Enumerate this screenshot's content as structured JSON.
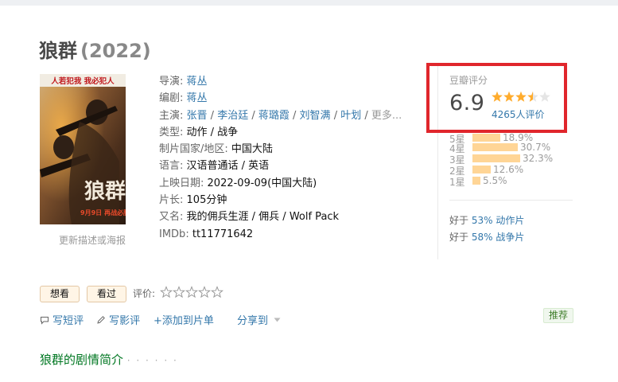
{
  "movie": {
    "title": "狼群",
    "year": "(2022)"
  },
  "poster": {
    "tagline": "人若犯我 我必犯人",
    "title_art": "狼群",
    "release_art": "9月9日 再战必胜",
    "update_link": "更新描述或海报"
  },
  "info": {
    "director": {
      "label": "导演:",
      "names": [
        "蒋丛"
      ]
    },
    "writer": {
      "label": "编剧:",
      "names": [
        "蒋丛"
      ]
    },
    "cast": {
      "label": "主演:",
      "names": [
        "张晋",
        "李治廷",
        "蒋璐霞",
        "刘智满",
        "叶划"
      ],
      "more": "更多..."
    },
    "genre": {
      "label": "类型:",
      "value": "动作 / 战争"
    },
    "country": {
      "label": "制片国家/地区:",
      "value": "中国大陆"
    },
    "language": {
      "label": "语言:",
      "value": "汉语普通话 / 英语"
    },
    "release": {
      "label": "上映日期:",
      "value": "2022-09-09(中国大陆)"
    },
    "runtime": {
      "label": "片长:",
      "value": "105分钟"
    },
    "aka": {
      "label": "又名:",
      "value": "我的佣兵生涯 / 佣兵 / Wolf Pack"
    },
    "imdb": {
      "label": "IMDb:",
      "value": "tt11771642"
    }
  },
  "rating": {
    "tag": "豆瓣评分",
    "score": "6.9",
    "stars": 3.5,
    "count": "4265人评价",
    "highlight_color": "#e0262c",
    "distribution": [
      {
        "label": "5星",
        "pct": "18.9%",
        "value": 18.9
      },
      {
        "label": "4星",
        "pct": "30.7%",
        "value": 30.7
      },
      {
        "label": "3星",
        "pct": "32.3%",
        "value": 32.3
      },
      {
        "label": "2星",
        "pct": "12.6%",
        "value": 12.6
      },
      {
        "label": "1星",
        "pct": "5.5%",
        "value": 5.5
      }
    ],
    "better_than": [
      {
        "prefix": "好于",
        "pct": "53%",
        "genre": "动作片"
      },
      {
        "prefix": "好于",
        "pct": "58%",
        "genre": "战争片"
      }
    ]
  },
  "actions": {
    "want": "想看",
    "seen": "看过",
    "my_rating_label": "评价:",
    "write_short": "写短评",
    "write_review": "写影评",
    "add_to_list": "+添加到片单",
    "share": "分享到",
    "recommend": "推荐"
  },
  "synopsis": {
    "title": "狼群的剧情简介",
    "dots": "· · · · · ·"
  },
  "icons": {
    "comment": "speech-bubble-icon",
    "pencil": "pencil-icon",
    "dropdown": "triangle-down-icon",
    "star": "star-icon"
  }
}
